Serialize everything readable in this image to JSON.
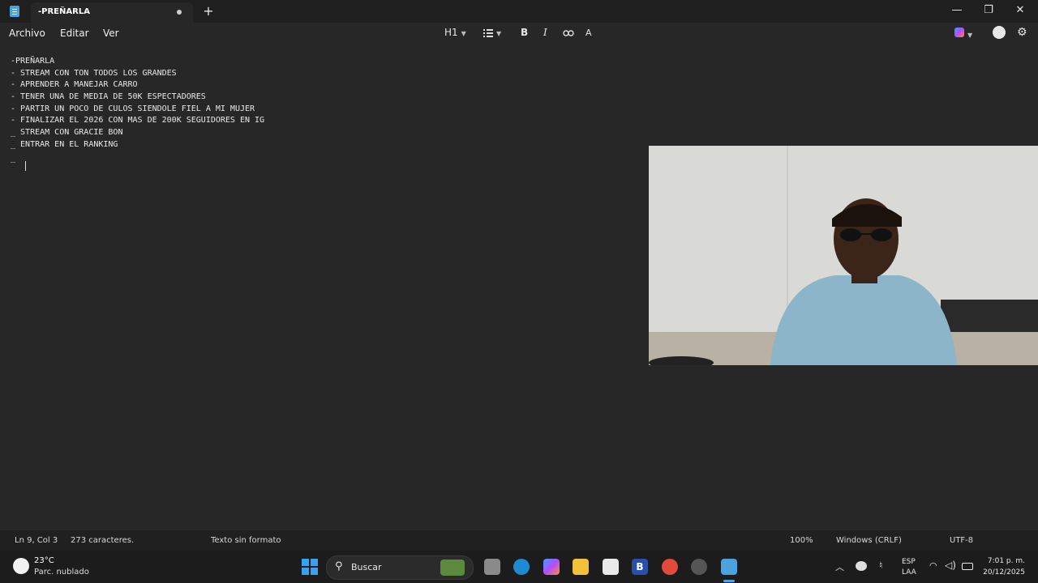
{
  "titlebar": {
    "tab_title": "-PREÑARLA",
    "new_tab": "+",
    "minimize": "—",
    "maximize": "❐",
    "close": "✕"
  },
  "menu": {
    "items": [
      "Archivo",
      "Editar",
      "Ver"
    ]
  },
  "toolbar": {
    "heading": "H1",
    "bold": "B",
    "italic": "I",
    "link": "⊂⊃",
    "spell": "A̶"
  },
  "editor": {
    "lines": [
      "-PREÑARLA",
      "- STREAM CON TON TODOS LOS GRANDES",
      "- APRENDER A MANEJAR CARRO",
      "- TENER UNA DE MEDIA DE 50K ESPECTADORES",
      "- PARTIR UN POCO DE CULOS SIENDOLE FIEL A MI MUJER",
      "- FINALIZAR EL 2026 CON MAS DE 200K SEGUIDORES EN IG",
      "_ STREAM CON GRACIE BON",
      "_ ENTRAR EN EL RANKING",
      "_"
    ]
  },
  "status": {
    "position": "Ln 9, Col 3",
    "chars": "273 caracteres.",
    "format": "Texto sin formato",
    "zoom": "100%",
    "line_ending": "Windows (CRLF)",
    "encoding": "UTF-8"
  },
  "taskbar": {
    "weather_temp": "23°C",
    "weather_desc": "Parc. nublado",
    "search_placeholder": "Buscar",
    "lang_top": "ESP",
    "lang_bottom": "LAA",
    "time": "7:01 p. m.",
    "date": "20/12/2025"
  },
  "colors": {
    "accent": "#4aa3df",
    "background": "#272727",
    "statusbar": "#202020",
    "taskbar": "#1c1c1c"
  }
}
